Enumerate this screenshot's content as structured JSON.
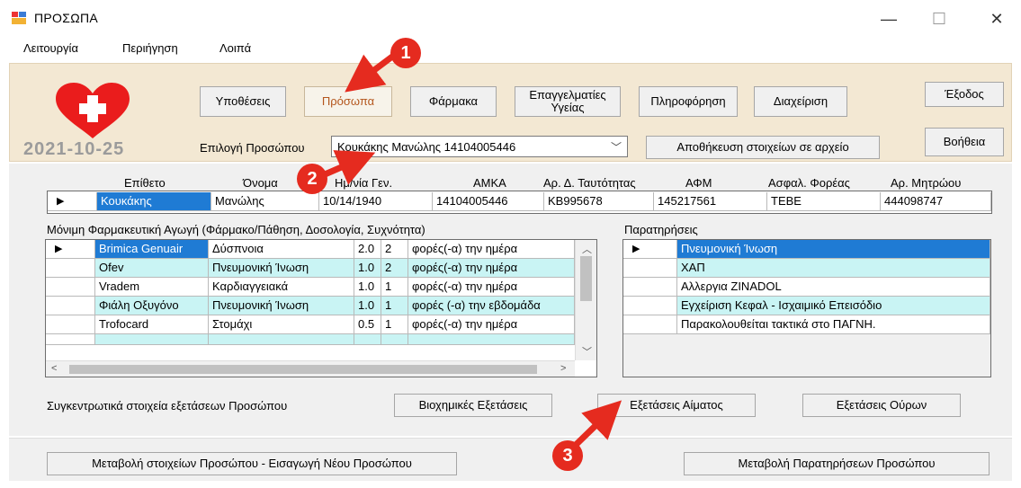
{
  "window": {
    "title": "ΠΡΟΣΩΠΑ"
  },
  "menu": [
    "Λειτουργία",
    "Περιήγηση",
    "Λοιπά"
  ],
  "date": "2021-10-25",
  "toolbar": {
    "hypotheseis": "Υποθέσεις",
    "prosopa": "Πρόσωπα",
    "farmaka": "Φάρμακα",
    "epaggelmaties": "Επαγγελματίες Υγείας",
    "pliroforisi": "Πληροφόρηση",
    "diaxeirisi": "Διαχείριση",
    "exodos": "Έξοδος",
    "voitheia": "Βοήθεια",
    "save_file": "Αποθήκευση στοιχείων σε αρχείο"
  },
  "person_select": {
    "label": "Επιλογή Προσώπου",
    "value": "Κουκάκης Μανώλης 14104005446"
  },
  "person_table": {
    "headers": [
      "Επίθετο",
      "Όνομα",
      "Ημ/νία Γεν.",
      "ΑΜΚΑ",
      "Αρ. Δ. Ταυτότητας",
      "ΑΦΜ",
      "Ασφαλ. Φορέας",
      "Αρ. Μητρώου"
    ],
    "row": [
      "Κουκάκης",
      "Μανώλης",
      "10/14/1940",
      "14104005446",
      "ΚΒ995678",
      "145217561",
      "ΤΕΒΕ",
      "444098747"
    ]
  },
  "medication": {
    "label": "Μόνιμη Φαρμακευτική Αγωγή (Φάρμακο/Πάθηση, Δοσολογία, Συχνότητα)",
    "rows": [
      [
        "Brimica Genuair",
        "Δύσπνοια",
        "2.0",
        "2",
        "φορές(-α) την ημέρα"
      ],
      [
        "Ofev",
        "Πνευμονική Ίνωση",
        "1.0",
        "2",
        "φορές(-α) την ημέρα"
      ],
      [
        "Vradem",
        "Καρδιαγγειακά",
        "1.0",
        "1",
        "φορές(-α) την ημέρα"
      ],
      [
        "Φιάλη Οξυγόνο",
        "Πνευμονική Ίνωση",
        "1.0",
        "1",
        "φορές (-α) την εβδομάδα"
      ],
      [
        "Trofocard",
        "Στομάχι",
        "0.5",
        "1",
        "φορές(-α) την ημέρα"
      ]
    ]
  },
  "notes": {
    "label": "Παρατηρήσεις",
    "rows": [
      "Πνευμονική Ίνωση",
      "ΧΑΠ",
      "Αλλεργια ZINADOL",
      "Εγχείριση Κεφαλ - Ισχαιμικό Επεισόδιο",
      "Παρακολουθείται τακτικά στο ΠΑΓΝΗ."
    ]
  },
  "exams": {
    "label": "Συγκεντρωτικά στοιχεία εξετάσεων Προσώπου",
    "biochem": "Βιοχημικές Εξετάσεις",
    "blood": "Εξετάσεις Αίματος",
    "urine": "Εξετάσεις Ούρων"
  },
  "bottom": {
    "edit_person": "Μεταβολή στοιχείων Προσώπου - Εισαγωγή Νέου Προσώπου",
    "edit_notes": "Μεταβολή Παρατηρήσεων Προσώπου"
  },
  "callouts": [
    "1",
    "2",
    "3"
  ],
  "colors": {
    "selected": "#1f7bd4",
    "alt_row": "#c9f4f4",
    "callout": "#e52b1f",
    "band": "#f3e8d3"
  }
}
